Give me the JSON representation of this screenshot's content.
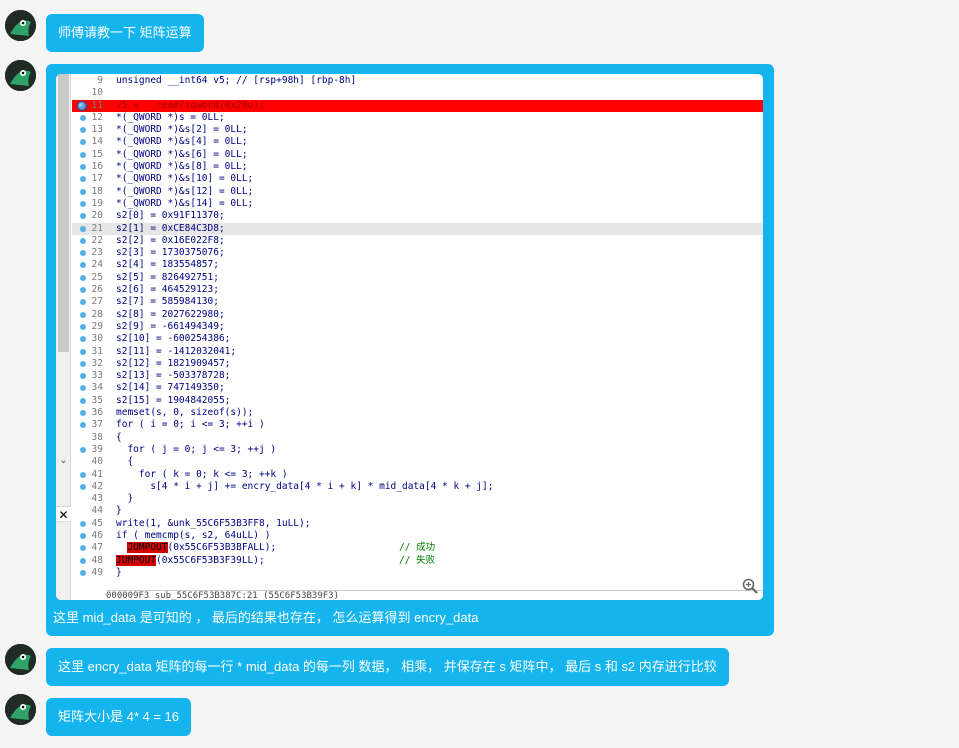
{
  "messages": [
    {
      "text": "师傅请教一下 矩阵运算"
    },
    {
      "caption": "这里 mid_data 是可知的 ， 最后的结果也存在， 怎么运算得到 encry_data",
      "code_lines": [
        {
          "n": "9",
          "t": "unsigned __int64 v5; // [rsp+98h] [rbp-8h]",
          "dot": "none"
        },
        {
          "n": "10",
          "t": "",
          "dot": "none"
        },
        {
          "n": "11",
          "t": "v5 = __readfsqword(0x28u);",
          "dot": "big",
          "bp": true
        },
        {
          "n": "12",
          "t": "*(_QWORD *)s = 0LL;",
          "dot": "small"
        },
        {
          "n": "13",
          "t": "*(_QWORD *)&s[2] = 0LL;",
          "dot": "small"
        },
        {
          "n": "14",
          "t": "*(_QWORD *)&s[4] = 0LL;",
          "dot": "small"
        },
        {
          "n": "15",
          "t": "*(_QWORD *)&s[6] = 0LL;",
          "dot": "small"
        },
        {
          "n": "16",
          "t": "*(_QWORD *)&s[8] = 0LL;",
          "dot": "small"
        },
        {
          "n": "17",
          "t": "*(_QWORD *)&s[10] = 0LL;",
          "dot": "small"
        },
        {
          "n": "18",
          "t": "*(_QWORD *)&s[12] = 0LL;",
          "dot": "small"
        },
        {
          "n": "19",
          "t": "*(_QWORD *)&s[14] = 0LL;",
          "dot": "small"
        },
        {
          "n": "20",
          "t": "s2[0] = 0x91F11370;",
          "dot": "small"
        },
        {
          "n": "21",
          "t": "s2[1] = 0xCE84C3D8;",
          "dot": "small",
          "cur": true
        },
        {
          "n": "22",
          "t": "s2[2] = 0x16E022F8;",
          "dot": "small"
        },
        {
          "n": "23",
          "t": "s2[3] = 1730375076;",
          "dot": "small"
        },
        {
          "n": "24",
          "t": "s2[4] = 183554857;",
          "dot": "small"
        },
        {
          "n": "25",
          "t": "s2[5] = 826492751;",
          "dot": "small"
        },
        {
          "n": "26",
          "t": "s2[6] = 464529123;",
          "dot": "small"
        },
        {
          "n": "27",
          "t": "s2[7] = 585984130;",
          "dot": "small"
        },
        {
          "n": "28",
          "t": "s2[8] = 2027622980;",
          "dot": "small"
        },
        {
          "n": "29",
          "t": "s2[9] = -661494349;",
          "dot": "small"
        },
        {
          "n": "30",
          "t": "s2[10] = -600254386;",
          "dot": "small"
        },
        {
          "n": "31",
          "t": "s2[11] = -1412032041;",
          "dot": "small"
        },
        {
          "n": "32",
          "t": "s2[12] = 1821909457;",
          "dot": "small"
        },
        {
          "n": "33",
          "t": "s2[13] = -503378728;",
          "dot": "small"
        },
        {
          "n": "34",
          "t": "s2[14] = 747149350;",
          "dot": "small"
        },
        {
          "n": "35",
          "t": "s2[15] = 1904842055;",
          "dot": "small"
        },
        {
          "n": "36",
          "t": "memset(s, 0, sizeof(s));",
          "dot": "small"
        },
        {
          "n": "37",
          "t": "for ( i = 0; i <= 3; ++i )",
          "dot": "small"
        },
        {
          "n": "38",
          "t": "{",
          "dot": "none"
        },
        {
          "n": "39",
          "t": "  for ( j = 0; j <= 3; ++j )",
          "dot": "small"
        },
        {
          "n": "40",
          "t": "  {",
          "dot": "none"
        },
        {
          "n": "41",
          "t": "    for ( k = 0; k <= 3; ++k )",
          "dot": "small"
        },
        {
          "n": "42",
          "t": "      s[4 * i + j] += encry_data[4 * i + k] * mid_data[4 * k + j];",
          "dot": "small"
        },
        {
          "n": "43",
          "t": "  }",
          "dot": "none"
        },
        {
          "n": "44",
          "t": "}",
          "dot": "none"
        },
        {
          "n": "45",
          "t": "write(1, &unk_55C6F53B3FF8, 1uLL);",
          "dot": "small"
        },
        {
          "n": "46",
          "t": "if ( memcmp(s, s2, 64uLL) )",
          "dot": "small"
        },
        {
          "n": "47",
          "t": "  JUMPOUT(0x55C6F53B3BFALL);",
          "comment": "// 成功",
          "dot": "small"
        },
        {
          "n": "48",
          "t": "JUMPOUT(0x55C6F53B3F39LL);",
          "comment": "// 失败",
          "dot": "small"
        },
        {
          "n": "49",
          "t": "}",
          "dot": "small"
        }
      ],
      "status_line": "000009F3 sub_55C6F53B387C:21 (55C6F53B39F3)"
    },
    {
      "text": "这里  encry_data 矩阵的每一行 *  mid_data 的每一列 数据， 相乘， 并保存在 s 矩阵中， 最后 s 和 s2 内存进行比较"
    },
    {
      "text": "矩阵大小是 4* 4 = 16"
    }
  ],
  "colors": {
    "bubble": "#14b4ee",
    "breakpoint": "#ff0000"
  },
  "icons": [
    "avatar",
    "zoom-in-icon",
    "close-icon",
    "chevron-down-icon"
  ]
}
